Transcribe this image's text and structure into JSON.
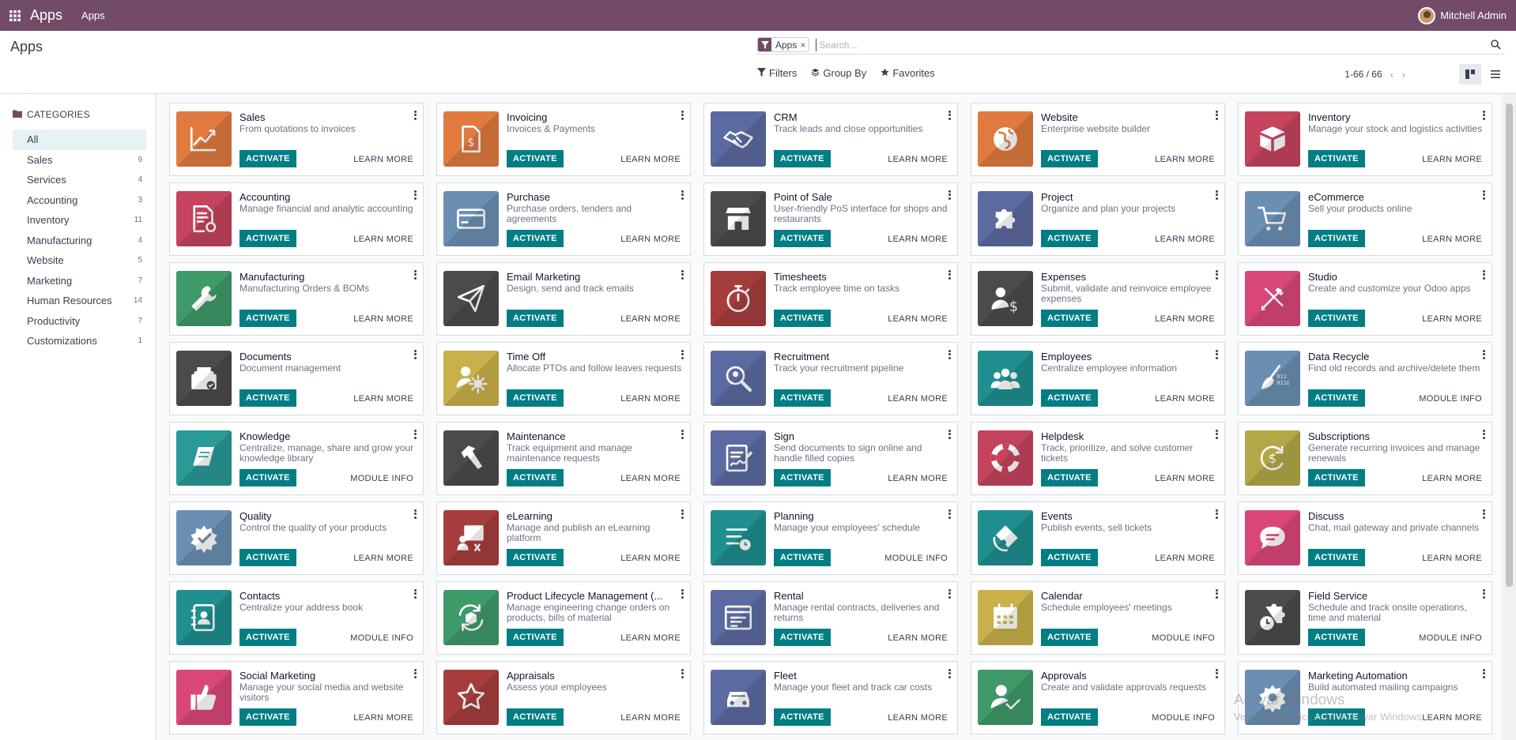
{
  "navbar": {
    "brand": "Apps",
    "menu": "Apps",
    "user": "Mitchell Admin"
  },
  "control_panel": {
    "title": "Apps",
    "facet": {
      "value": "Apps"
    },
    "search_placeholder": "Search...",
    "filters_label": "Filters",
    "groupby_label": "Group By",
    "favorites_label": "Favorites",
    "pager": "1-66 / 66"
  },
  "sidebar": {
    "heading": "CATEGORIES",
    "items": [
      {
        "label": "All",
        "count": ""
      },
      {
        "label": "Sales",
        "count": "9"
      },
      {
        "label": "Services",
        "count": "4"
      },
      {
        "label": "Accounting",
        "count": "3"
      },
      {
        "label": "Inventory",
        "count": "11"
      },
      {
        "label": "Manufacturing",
        "count": "4"
      },
      {
        "label": "Website",
        "count": "5"
      },
      {
        "label": "Marketing",
        "count": "7"
      },
      {
        "label": "Human Resources",
        "count": "14"
      },
      {
        "label": "Productivity",
        "count": "7"
      },
      {
        "label": "Customizations",
        "count": "1"
      }
    ]
  },
  "labels": {
    "activate": "ACTIVATE",
    "learn_more": "LEARN MORE",
    "module_info": "MODULE INFO"
  },
  "apps": [
    {
      "name": "Sales",
      "summary": "From quotations to invoices",
      "color": "#e07a3f",
      "icon": "chart-trend-icon",
      "link": "LEARN MORE"
    },
    {
      "name": "Invoicing",
      "summary": "Invoices & Payments",
      "color": "#e07a3f",
      "icon": "invoice-dollar-icon",
      "link": "LEARN MORE"
    },
    {
      "name": "CRM",
      "summary": "Track leads and close opportunities",
      "color": "#5b6aa0",
      "icon": "handshake-icon",
      "link": "LEARN MORE"
    },
    {
      "name": "Website",
      "summary": "Enterprise website builder",
      "color": "#e07a3f",
      "icon": "globe-icon",
      "link": "LEARN MORE"
    },
    {
      "name": "Inventory",
      "summary": "Manage your stock and logistics activities",
      "color": "#c5435c",
      "icon": "box-icon",
      "link": "LEARN MORE"
    },
    {
      "name": "Accounting",
      "summary": "Manage financial and analytic accounting",
      "color": "#c5435c",
      "icon": "document-gear-icon",
      "link": "LEARN MORE"
    },
    {
      "name": "Purchase",
      "summary": "Purchase orders, tenders and agreements",
      "color": "#6b8fb3",
      "icon": "credit-card-icon",
      "link": "LEARN MORE"
    },
    {
      "name": "Point of Sale",
      "summary": "User-friendly PoS interface for shops and restaurants",
      "color": "#4b4b4b",
      "icon": "shop-icon",
      "link": "LEARN MORE"
    },
    {
      "name": "Project",
      "summary": "Organize and plan your projects",
      "color": "#5b6aa0",
      "icon": "puzzle-icon",
      "link": "LEARN MORE"
    },
    {
      "name": "eCommerce",
      "summary": "Sell your products online",
      "color": "#6b8fb3",
      "icon": "cart-icon",
      "link": "LEARN MORE"
    },
    {
      "name": "Manufacturing",
      "summary": "Manufacturing Orders & BOMs",
      "color": "#3f9a6a",
      "icon": "wrench-icon",
      "link": "LEARN MORE"
    },
    {
      "name": "Email Marketing",
      "summary": "Design, send and track emails",
      "color": "#4b4b4b",
      "icon": "paper-plane-icon",
      "link": "LEARN MORE"
    },
    {
      "name": "Timesheets",
      "summary": "Track employee time on tasks",
      "color": "#a63d3d",
      "icon": "stopwatch-icon",
      "link": "LEARN MORE"
    },
    {
      "name": "Expenses",
      "summary": "Submit, validate and reinvoice employee expenses",
      "color": "#4b4b4b",
      "icon": "person-dollar-icon",
      "link": "LEARN MORE"
    },
    {
      "name": "Studio",
      "summary": "Create and customize your Odoo apps",
      "color": "#d9477a",
      "icon": "tools-icon",
      "link": "LEARN MORE"
    },
    {
      "name": "Documents",
      "summary": "Document management",
      "color": "#4b4b4b",
      "icon": "file-box-icon",
      "link": "LEARN MORE"
    },
    {
      "name": "Time Off",
      "summary": "Allocate PTOs and follow leaves requests",
      "color": "#c9b04a",
      "icon": "person-sun-icon",
      "link": "LEARN MORE"
    },
    {
      "name": "Recruitment",
      "summary": "Track your recruitment pipeline",
      "color": "#5b6aa0",
      "icon": "magnifier-icon",
      "link": "LEARN MORE"
    },
    {
      "name": "Employees",
      "summary": "Centralize employee information",
      "color": "#1f8f8f",
      "icon": "people-icon",
      "link": "LEARN MORE"
    },
    {
      "name": "Data Recycle",
      "summary": "Find old records and archive/delete them",
      "color": "#6b8fb3",
      "icon": "broom-icon",
      "link": "MODULE INFO"
    },
    {
      "name": "Knowledge",
      "summary": "Centralize, manage, share and grow your knowledge library",
      "color": "#2a9a96",
      "icon": "book-icon",
      "link": "MODULE INFO"
    },
    {
      "name": "Maintenance",
      "summary": "Track equipment and manage maintenance requests",
      "color": "#4b4b4b",
      "icon": "hammer-icon",
      "link": "LEARN MORE"
    },
    {
      "name": "Sign",
      "summary": "Send documents to sign online and handle filled copies",
      "color": "#5b6aa0",
      "icon": "signature-icon",
      "link": "LEARN MORE"
    },
    {
      "name": "Helpdesk",
      "summary": "Track, prioritize, and solve customer tickets",
      "color": "#c5435c",
      "icon": "lifebuoy-icon",
      "link": "LEARN MORE"
    },
    {
      "name": "Subscriptions",
      "summary": "Generate recurring invoices and manage renewals",
      "color": "#b3a846",
      "icon": "recurring-dollar-icon",
      "link": "LEARN MORE"
    },
    {
      "name": "Quality",
      "summary": "Control the quality of your products",
      "color": "#6b8fb3",
      "icon": "quality-gear-icon",
      "link": "LEARN MORE"
    },
    {
      "name": "eLearning",
      "summary": "Manage and publish an eLearning platform",
      "color": "#a63d3d",
      "icon": "presentation-icon",
      "link": "LEARN MORE"
    },
    {
      "name": "Planning",
      "summary": "Manage your employees' schedule",
      "color": "#1f8f8f",
      "icon": "schedule-icon",
      "link": "MODULE INFO"
    },
    {
      "name": "Events",
      "summary": "Publish events, sell tickets",
      "color": "#1f8f8f",
      "icon": "ticket-icon",
      "link": "LEARN MORE"
    },
    {
      "name": "Discuss",
      "summary": "Chat, mail gateway and private channels",
      "color": "#d9477a",
      "icon": "chat-bubble-icon",
      "link": "LEARN MORE"
    },
    {
      "name": "Contacts",
      "summary": "Centralize your address book",
      "color": "#1f8f8f",
      "icon": "address-book-icon",
      "link": "MODULE INFO"
    },
    {
      "name": "Product Lifecycle Management (...",
      "summary": "Manage engineering change orders on products, bills of material",
      "color": "#3f9a6a",
      "icon": "cycle-box-icon",
      "link": "LEARN MORE"
    },
    {
      "name": "Rental",
      "summary": "Manage rental contracts, deliveries and returns",
      "color": "#5b6aa0",
      "icon": "rental-calendar-icon",
      "link": "LEARN MORE"
    },
    {
      "name": "Calendar",
      "summary": "Schedule employees' meetings",
      "color": "#c9b04a",
      "icon": "calendar-icon",
      "link": "MODULE INFO"
    },
    {
      "name": "Field Service",
      "summary": "Schedule and track onsite operations, time and material",
      "color": "#4b4b4b",
      "icon": "puzzle-clock-icon",
      "link": "MODULE INFO"
    },
    {
      "name": "Social Marketing",
      "summary": "Manage your social media and website visitors",
      "color": "#d9477a",
      "icon": "thumbs-up-icon",
      "link": "LEARN MORE"
    },
    {
      "name": "Appraisals",
      "summary": "Assess your employees",
      "color": "#a63d3d",
      "icon": "star-icon",
      "link": "LEARN MORE"
    },
    {
      "name": "Fleet",
      "summary": "Manage your fleet and track car costs",
      "color": "#5b6aa0",
      "icon": "car-icon",
      "link": "LEARN MORE"
    },
    {
      "name": "Approvals",
      "summary": "Create and validate approvals requests",
      "color": "#3f9a6a",
      "icon": "person-check-icon",
      "link": "MODULE INFO"
    },
    {
      "name": "Marketing Automation",
      "summary": "Build automated mailing campaigns",
      "color": "#6b8fb3",
      "icon": "automation-gear-icon",
      "link": "LEARN MORE"
    }
  ],
  "watermark": {
    "title": "Activar Windows",
    "subtitle": "Ve a Configuración para activar Windows."
  }
}
